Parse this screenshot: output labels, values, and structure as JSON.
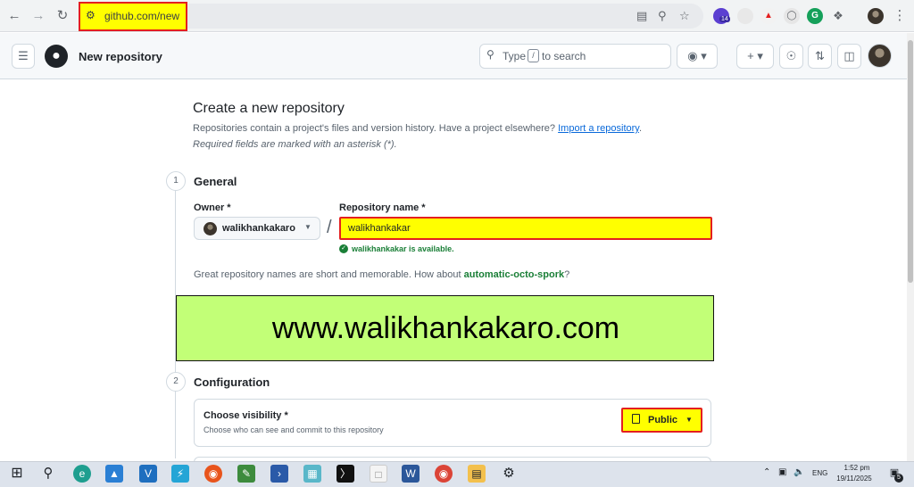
{
  "browser": {
    "url": "github.com/new",
    "extensions": [
      {
        "icon": "copilot-extension-icon",
        "badge": "14",
        "color": "#5b3fd1"
      },
      {
        "icon": "tab-extension-icon",
        "color": "#e8e8e8"
      },
      {
        "icon": "tagged-extension-icon",
        "color": "#f2f2f2"
      },
      {
        "icon": "shield-extension-icon",
        "color": "#e6e6e6"
      },
      {
        "icon": "grammarly-icon",
        "color": "#15a05a"
      },
      {
        "icon": "puzzle-icon",
        "color": "#f1f3f4"
      }
    ]
  },
  "header": {
    "title": "New repository",
    "search_placeholder_before": "Type",
    "search_key": "/",
    "search_placeholder_after": "to search"
  },
  "form": {
    "heading": "Create a new repository",
    "intro_text": "Repositories contain a project's files and version history. Have a project elsewhere?",
    "import_link": "Import a repository",
    "intro_end": ".",
    "required_note": "Required fields are marked with an asterisk (*).",
    "steps": [
      {
        "number": "1",
        "title": "General"
      },
      {
        "number": "2",
        "title": "Configuration"
      }
    ],
    "owner_label": "Owner *",
    "owner_value": "walikhankakaro",
    "repo_label": "Repository name *",
    "repo_value": "walikhankakar",
    "available_text": "walikhankakar is available.",
    "suggest_text": "Great repository names are short and memorable. How about",
    "suggest_name": "automatic-octo-spork",
    "suggest_end": "?",
    "visibility_label": "Choose visibility *",
    "visibility_desc": "Choose who can see and commit to this repository",
    "visibility_value": "Public"
  },
  "banner": {
    "text": "www.walikhankakaro.com",
    "color": "#c2ff77"
  },
  "taskbar": {
    "lang": "ENG",
    "time": "1:52 pm",
    "date": "19/11/2025",
    "notifications": "5"
  }
}
